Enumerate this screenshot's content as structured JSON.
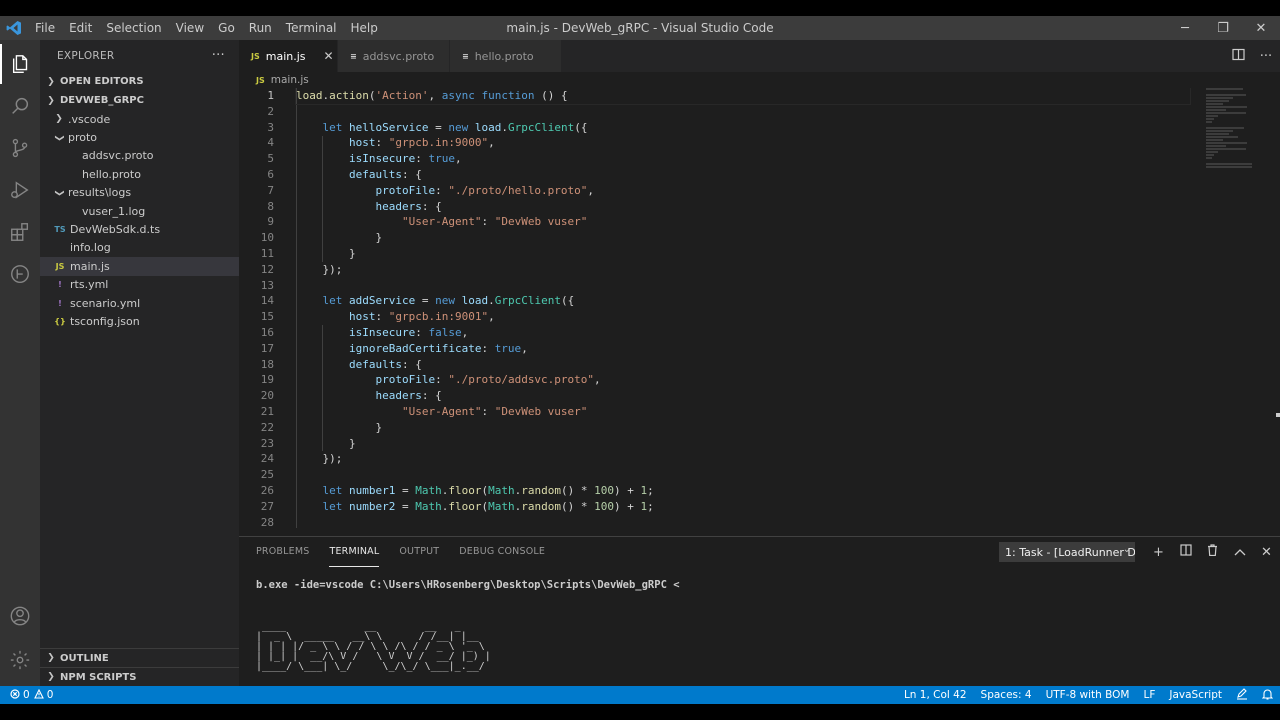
{
  "window": {
    "title": "main.js - DevWeb_gRPC - Visual Studio Code",
    "menu": [
      "File",
      "Edit",
      "Selection",
      "View",
      "Go",
      "Run",
      "Terminal",
      "Help"
    ],
    "controls": {
      "minimize": "─",
      "maximize": "❐",
      "close": "✕"
    }
  },
  "activity_bar": {
    "icons": [
      "explorer-icon",
      "search-icon",
      "source-control-icon",
      "run-debug-icon",
      "extensions-icon",
      "loadrunner-icon",
      "account-icon",
      "settings-gear-icon"
    ]
  },
  "sidebar": {
    "title": "EXPLORER",
    "more": "···",
    "open_editors": "OPEN EDITORS",
    "project": "DEVWEB_GRPC",
    "tree": [
      {
        "label": ".vscode",
        "type": "folder",
        "expanded": false,
        "indent": 1
      },
      {
        "label": "proto",
        "type": "folder",
        "expanded": true,
        "indent": 1
      },
      {
        "label": "addsvc.proto",
        "type": "file",
        "icon": "",
        "indent": 2
      },
      {
        "label": "hello.proto",
        "type": "file",
        "icon": "",
        "indent": 2
      },
      {
        "label": "results\\logs",
        "type": "folder",
        "expanded": true,
        "indent": 1
      },
      {
        "label": "vuser_1.log",
        "type": "file",
        "icon": "",
        "indent": 2
      },
      {
        "label": "DevWebSdk.d.ts",
        "type": "file",
        "icon": "TS",
        "icon_color": "#519aba",
        "indent": 1
      },
      {
        "label": "info.log",
        "type": "file",
        "icon": "",
        "indent": 1
      },
      {
        "label": "main.js",
        "type": "file",
        "icon": "JS",
        "icon_color": "#cbcb41",
        "indent": 1,
        "selected": true
      },
      {
        "label": "rts.yml",
        "type": "file",
        "icon": "!",
        "icon_color": "#a074c4",
        "indent": 1
      },
      {
        "label": "scenario.yml",
        "type": "file",
        "icon": "!",
        "icon_color": "#a074c4",
        "indent": 1
      },
      {
        "label": "tsconfig.json",
        "type": "file",
        "icon": "{}",
        "icon_color": "#cbcb41",
        "indent": 1
      }
    ],
    "outline": "OUTLINE",
    "npm_scripts": "NPM SCRIPTS"
  },
  "tabs": [
    {
      "label": "main.js",
      "icon": "JS",
      "icon_color": "#cbcb41",
      "active": true,
      "close": "✕"
    },
    {
      "label": "addsvc.proto",
      "icon": "≡",
      "icon_color": "#cccccc",
      "active": false
    },
    {
      "label": "hello.proto",
      "icon": "≡",
      "icon_color": "#cccccc",
      "active": false
    }
  ],
  "breadcrumb": {
    "icon": "JS",
    "file": "main.js"
  },
  "editor": {
    "current_line": 1,
    "lines": [
      [
        [
          "fn",
          "load"
        ],
        [
          "",
          "."
        ],
        [
          "fn",
          "action"
        ],
        [
          "",
          "("
        ],
        [
          "str",
          "'Action'"
        ],
        [
          "",
          ", "
        ],
        [
          "kw",
          "async"
        ],
        [
          "",
          " "
        ],
        [
          "kw",
          "function"
        ],
        [
          "",
          " () {"
        ]
      ],
      [],
      [
        [
          "",
          "    "
        ],
        [
          "kw",
          "let"
        ],
        [
          "",
          " "
        ],
        [
          "prop",
          "helloService"
        ],
        [
          "",
          " = "
        ],
        [
          "kw",
          "new"
        ],
        [
          "",
          " "
        ],
        [
          "prop",
          "load"
        ],
        [
          "",
          "."
        ],
        [
          "cls",
          "GrpcClient"
        ],
        [
          "",
          "({"
        ]
      ],
      [
        [
          "",
          "        "
        ],
        [
          "prop",
          "host"
        ],
        [
          "",
          ": "
        ],
        [
          "str",
          "\"grpcb.in:9000\""
        ],
        [
          "",
          ","
        ]
      ],
      [
        [
          "",
          "        "
        ],
        [
          "prop",
          "isInsecure"
        ],
        [
          "",
          ": "
        ],
        [
          "kw",
          "true"
        ],
        [
          "",
          ","
        ]
      ],
      [
        [
          "",
          "        "
        ],
        [
          "prop",
          "defaults"
        ],
        [
          "",
          ": {"
        ]
      ],
      [
        [
          "",
          "            "
        ],
        [
          "prop",
          "protoFile"
        ],
        [
          "",
          ": "
        ],
        [
          "str",
          "\"./proto/hello.proto\""
        ],
        [
          "",
          ","
        ]
      ],
      [
        [
          "",
          "            "
        ],
        [
          "prop",
          "headers"
        ],
        [
          "",
          ": {"
        ]
      ],
      [
        [
          "",
          "                "
        ],
        [
          "str",
          "\"User-Agent\""
        ],
        [
          "",
          ": "
        ],
        [
          "str",
          "\"DevWeb vuser\""
        ]
      ],
      [
        [
          "",
          "            }"
        ]
      ],
      [
        [
          "",
          "        }"
        ]
      ],
      [
        [
          "",
          "    });"
        ]
      ],
      [],
      [
        [
          "",
          "    "
        ],
        [
          "kw",
          "let"
        ],
        [
          "",
          " "
        ],
        [
          "prop",
          "addService"
        ],
        [
          "",
          " = "
        ],
        [
          "kw",
          "new"
        ],
        [
          "",
          " "
        ],
        [
          "prop",
          "load"
        ],
        [
          "",
          "."
        ],
        [
          "cls",
          "GrpcClient"
        ],
        [
          "",
          "({"
        ]
      ],
      [
        [
          "",
          "        "
        ],
        [
          "prop",
          "host"
        ],
        [
          "",
          ": "
        ],
        [
          "str",
          "\"grpcb.in:9001\""
        ],
        [
          "",
          ","
        ]
      ],
      [
        [
          "",
          "        "
        ],
        [
          "prop",
          "isInsecure"
        ],
        [
          "",
          ": "
        ],
        [
          "kw",
          "false"
        ],
        [
          "",
          ","
        ]
      ],
      [
        [
          "",
          "        "
        ],
        [
          "prop",
          "ignoreBadCertificate"
        ],
        [
          "",
          ": "
        ],
        [
          "kw",
          "true"
        ],
        [
          "",
          ","
        ]
      ],
      [
        [
          "",
          "        "
        ],
        [
          "prop",
          "defaults"
        ],
        [
          "",
          ": {"
        ]
      ],
      [
        [
          "",
          "            "
        ],
        [
          "prop",
          "protoFile"
        ],
        [
          "",
          ": "
        ],
        [
          "str",
          "\"./proto/addsvc.proto\""
        ],
        [
          "",
          ","
        ]
      ],
      [
        [
          "",
          "            "
        ],
        [
          "prop",
          "headers"
        ],
        [
          "",
          ": {"
        ]
      ],
      [
        [
          "",
          "                "
        ],
        [
          "str",
          "\"User-Agent\""
        ],
        [
          "",
          ": "
        ],
        [
          "str",
          "\"DevWeb vuser\""
        ]
      ],
      [
        [
          "",
          "            }"
        ]
      ],
      [
        [
          "",
          "        }"
        ]
      ],
      [
        [
          "",
          "    });"
        ]
      ],
      [],
      [
        [
          "",
          "    "
        ],
        [
          "kw",
          "let"
        ],
        [
          "",
          " "
        ],
        [
          "prop",
          "number1"
        ],
        [
          "",
          " = "
        ],
        [
          "cls",
          "Math"
        ],
        [
          "",
          "."
        ],
        [
          "fn",
          "floor"
        ],
        [
          "",
          "("
        ],
        [
          "cls",
          "Math"
        ],
        [
          "",
          "."
        ],
        [
          "fn",
          "random"
        ],
        [
          "",
          "() * "
        ],
        [
          "num",
          "100"
        ],
        [
          "",
          ") + "
        ],
        [
          "num",
          "1"
        ],
        [
          "",
          ";"
        ]
      ],
      [
        [
          "",
          "    "
        ],
        [
          "kw",
          "let"
        ],
        [
          "",
          " "
        ],
        [
          "prop",
          "number2"
        ],
        [
          "",
          " = "
        ],
        [
          "cls",
          "Math"
        ],
        [
          "",
          "."
        ],
        [
          "fn",
          "floor"
        ],
        [
          "",
          "("
        ],
        [
          "cls",
          "Math"
        ],
        [
          "",
          "."
        ],
        [
          "fn",
          "random"
        ],
        [
          "",
          "() * "
        ],
        [
          "num",
          "100"
        ],
        [
          "",
          ") + "
        ],
        [
          "num",
          "1"
        ],
        [
          "",
          ";"
        ]
      ],
      []
    ]
  },
  "panel": {
    "tabs": [
      "PROBLEMS",
      "TERMINAL",
      "OUTPUT",
      "DEBUG CONSOLE"
    ],
    "active_tab": "TERMINAL",
    "task_select": "1: Task - [LoadRunner D",
    "actions": [
      "+",
      "⊟",
      "🗑",
      "︿",
      "✕"
    ],
    "command": "b.exe -ide=vscode C:\\Users\\HRosenberg\\Desktop\\Scripts\\DevWeb_gRPC <",
    "ascii_art": [
      " ____             __        __   _     ",
      "|  _ \\  _____   __\\ \\      / /__| |__  ",
      "| | | |/ _ \\ \\ / / \\ \\ /\\ / / _ \\ '_ \\ ",
      "| |_| |  __/\\ V /   \\ V  V /  __/ |_) |",
      "|____/ \\___| \\_/     \\_/\\_/ \\___|_.__/ "
    ]
  },
  "statusbar": {
    "errors": "0",
    "warnings": "0",
    "position": "Ln 1, Col 42",
    "spaces": "Spaces: 4",
    "encoding": "UTF-8 with BOM",
    "eol": "LF",
    "language": "JavaScript"
  }
}
